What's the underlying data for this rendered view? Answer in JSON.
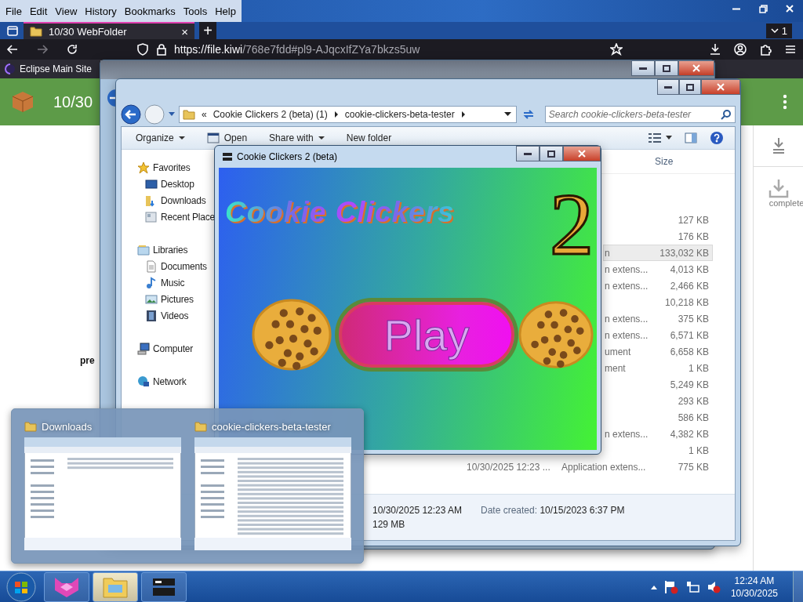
{
  "browser": {
    "menu": [
      "File",
      "Edit",
      "View",
      "History",
      "Bookmarks",
      "Tools",
      "Help"
    ],
    "tabs": [
      {
        "title": "10/30 WebFolder",
        "close": "×",
        "selected": true
      }
    ],
    "new_tab": "+",
    "tab_count": "1",
    "url": {
      "host": "https://file.kiwi",
      "path": "/768e7fdd#pl9-AJqcxIfZYa7bkzs5uw"
    },
    "bookmarks": [
      "Eclipse Main Site"
    ],
    "page": {
      "title": "10/30",
      "side_text": "pre",
      "download_status": "complete"
    }
  },
  "explorer": {
    "breadcrumb_prefix": "«",
    "breadcrumb": [
      "Cookie Clickers 2 (beta) (1)",
      "cookie-clickers-beta-tester"
    ],
    "search_placeholder": "Search cookie-clickers-beta-tester",
    "toolbar": [
      {
        "label": "Organize",
        "kind": "menu"
      },
      {
        "label": "Open",
        "kind": "icon"
      },
      {
        "label": "Share with",
        "kind": "menu"
      },
      {
        "label": "New folder",
        "kind": "plain"
      }
    ],
    "nav": [
      {
        "label": "Favorites",
        "kind": "star",
        "children": [
          {
            "label": "Desktop",
            "kind": "desktop"
          },
          {
            "label": "Downloads",
            "kind": "downloads"
          },
          {
            "label": "Recent Place",
            "kind": "recent"
          }
        ]
      },
      {
        "label": "Libraries",
        "kind": "libraries",
        "children": [
          {
            "label": "Documents",
            "kind": "documents"
          },
          {
            "label": "Music",
            "kind": "music"
          },
          {
            "label": "Pictures",
            "kind": "pictures"
          },
          {
            "label": "Videos",
            "kind": "videos"
          }
        ]
      },
      {
        "label": "Computer",
        "kind": "computer"
      },
      {
        "label": "Network",
        "kind": "network"
      }
    ],
    "size_header": "Size",
    "rows": [
      {
        "size": "127 KB",
        "selected": false
      },
      {
        "size": "176 KB",
        "selected": false
      },
      {
        "type": "n",
        "size": "133,032 KB",
        "selected": true
      },
      {
        "type": "n extens...",
        "size": "4,013 KB",
        "selected": false
      },
      {
        "type": "n extens...",
        "size": "2,466 KB",
        "selected": false
      },
      {
        "size": "10,218 KB",
        "selected": false
      },
      {
        "type": "n extens...",
        "size": "375 KB",
        "selected": false
      },
      {
        "type": "n extens...",
        "size": "6,571 KB",
        "selected": false
      },
      {
        "type": "ument",
        "size": "6,658 KB",
        "selected": false
      },
      {
        "type": "ment",
        "size": "1 KB",
        "selected": false
      },
      {
        "size": "5,249 KB",
        "selected": false
      },
      {
        "size": "293 KB",
        "selected": false
      },
      {
        "size": "586 KB",
        "selected": false
      },
      {
        "type": "n extens...",
        "size": "4,382 KB",
        "selected": false
      },
      {
        "size": "1 KB",
        "selected": false
      },
      {
        "date": "10/30/2025 12:23 ...",
        "type": "Application extens...",
        "size": "775 KB",
        "selected": false
      }
    ],
    "details": {
      "modified": "10/30/2025 12:23 AM",
      "created_label": "Date created:",
      "created": "10/15/2023 6:37 PM",
      "size": "129 MB"
    }
  },
  "game": {
    "title": "Cookie Clickers 2 (beta)",
    "logo": "Cookie Clickers",
    "logo_number": "2",
    "play": "Play"
  },
  "thumbnails": [
    {
      "title": "Downloads",
      "kind": "short"
    },
    {
      "title": "cookie-clickers-beta-tester",
      "kind": "long"
    }
  ],
  "taskbar": {
    "apps": [
      {
        "kind": "fox",
        "selected": false
      },
      {
        "kind": "explorer",
        "selected": true
      },
      {
        "kind": "game",
        "selected": false
      }
    ],
    "time": "12:24 AM",
    "date": "10/30/2025"
  }
}
